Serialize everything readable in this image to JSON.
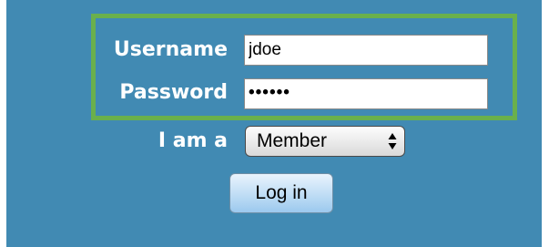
{
  "form": {
    "username_label": "Username",
    "username_value": "jdoe",
    "password_label": "Password",
    "password_value": "••••••",
    "role_label": "I am a",
    "role_selected": "Member",
    "login_label": "Log in"
  },
  "colors": {
    "panel_background": "#418ab3",
    "highlight_border": "#6ab04c",
    "label_text": "#ffffff"
  }
}
